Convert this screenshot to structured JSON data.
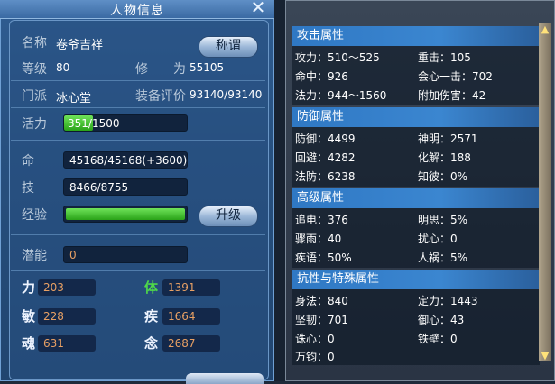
{
  "window": {
    "title": "人物信息"
  },
  "profile": {
    "name_label": "名称",
    "name": "卷爷吉祥",
    "title_button": "称谓",
    "level_label": "等级",
    "level": "80",
    "cultivation_label": "修　　为",
    "cultivation": "55105",
    "sect_label": "门派",
    "sect": "冰心堂",
    "gear_label": "装备评价",
    "gear_score": "93140/93140"
  },
  "vitals": {
    "vigor_label": "活力",
    "vigor": "351/1500",
    "vigor_fraction": 0.234,
    "hp_label": "命",
    "hp": "45168/45168(+3600)",
    "skill_label": "技",
    "skill": "8466/8755",
    "exp_label": "经验",
    "exp_fraction": 1.0,
    "upgrade_button": "升级",
    "potential_label": "潜能",
    "potential": "0"
  },
  "stats": [
    {
      "label": "力",
      "value": "203",
      "color": "#eef4ff"
    },
    {
      "label": "体",
      "value": "1391",
      "color": "#4fd84a"
    },
    {
      "label": "敏",
      "value": "228",
      "color": "#eef4ff"
    },
    {
      "label": "疾",
      "value": "1664",
      "color": "#eef4ff"
    },
    {
      "label": "魂",
      "value": "631",
      "color": "#eef4ff"
    },
    {
      "label": "念",
      "value": "2687",
      "color": "#eef4ff"
    }
  ],
  "attack": {
    "header": "攻击属性",
    "items": [
      "攻力：510～525",
      "重击：105",
      "命中：926",
      "会心一击：702",
      "法力：944～1560",
      "附加伤害：42"
    ]
  },
  "defense": {
    "header": "防御属性",
    "items": [
      "防御：4499",
      "神明：2571",
      "回避：4282",
      "化解：188",
      "法防：6238",
      "知彼：0%"
    ]
  },
  "advanced": {
    "header": "高级属性",
    "items": [
      "追电：376",
      "明思：5%",
      "骤雨：40",
      "扰心：0",
      "疾语：50%",
      "人祸：5%"
    ]
  },
  "resist": {
    "header": "抗性与特殊属性",
    "items": [
      "身法：840",
      "定力：1443",
      "坚韧：701",
      "御心：43",
      "诛心：0",
      "铁壁：0",
      "万钧：0"
    ]
  }
}
